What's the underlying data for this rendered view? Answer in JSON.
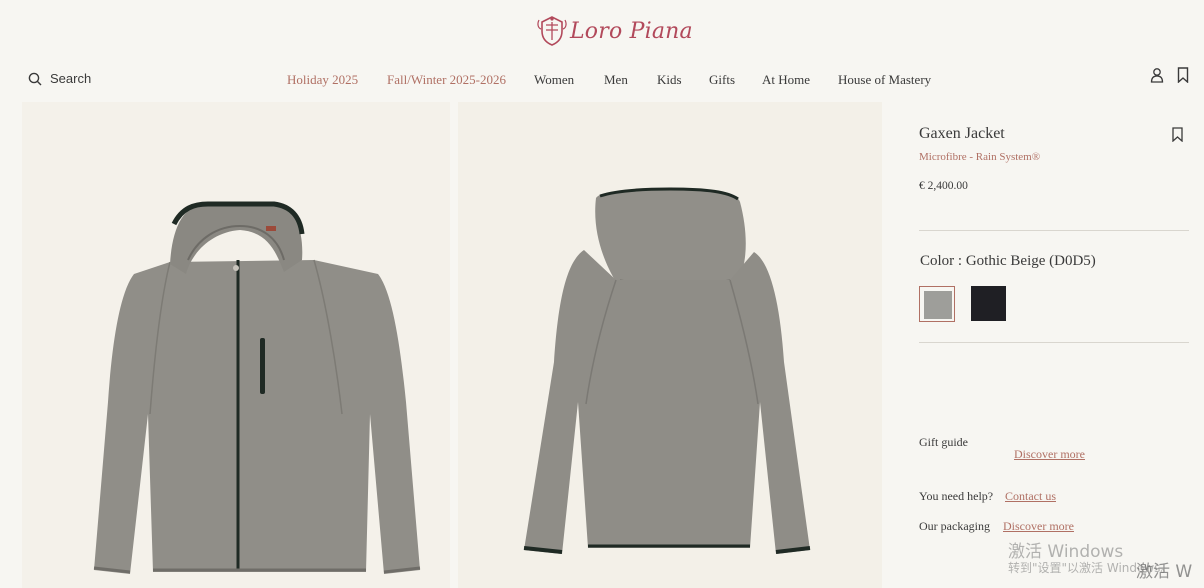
{
  "brand": {
    "name": "Loro Piana",
    "color": "#b2495b"
  },
  "header": {
    "search_label": "Search",
    "nav": [
      {
        "label": "Holiday 2025",
        "accent": true
      },
      {
        "label": "Fall/Winter 2025-2026",
        "accent": true
      },
      {
        "label": "Women",
        "accent": false
      },
      {
        "label": "Men",
        "accent": false
      },
      {
        "label": "Kids",
        "accent": false
      },
      {
        "label": "Gifts",
        "accent": false
      },
      {
        "label": "At Home",
        "accent": false
      },
      {
        "label": "House of Mastery",
        "accent": false
      }
    ],
    "icons": [
      "user-icon",
      "bookmark-icon"
    ]
  },
  "product": {
    "title": "Gaxen Jacket",
    "subtitle": "Microfibre - Rain System®",
    "price": "€ 2,400.00",
    "color_label": "Color : Gothic Beige (D0D5)",
    "swatches": [
      {
        "name": "Gothic Beige",
        "hex": "#9e9e9a",
        "selected": true
      },
      {
        "name": "Dark",
        "hex": "#1f1f24",
        "selected": false
      }
    ],
    "images": [
      {
        "view": "front",
        "jacket_color": "#908e88",
        "trim_color": "#1f2a24"
      },
      {
        "view": "back",
        "jacket_color": "#8f8d87",
        "trim_color": "#1f2a24"
      }
    ]
  },
  "info": {
    "gift_label": "Gift guide",
    "gift_link": "Discover more",
    "help_label": "You need help?",
    "help_link": "Contact us",
    "packaging_label": "Our packaging",
    "packaging_link": "Discover more"
  },
  "watermark": {
    "line1": "激活 Windows",
    "line2": "转到\"设置\"以激活 Windows。",
    "line3": "激活 W"
  }
}
